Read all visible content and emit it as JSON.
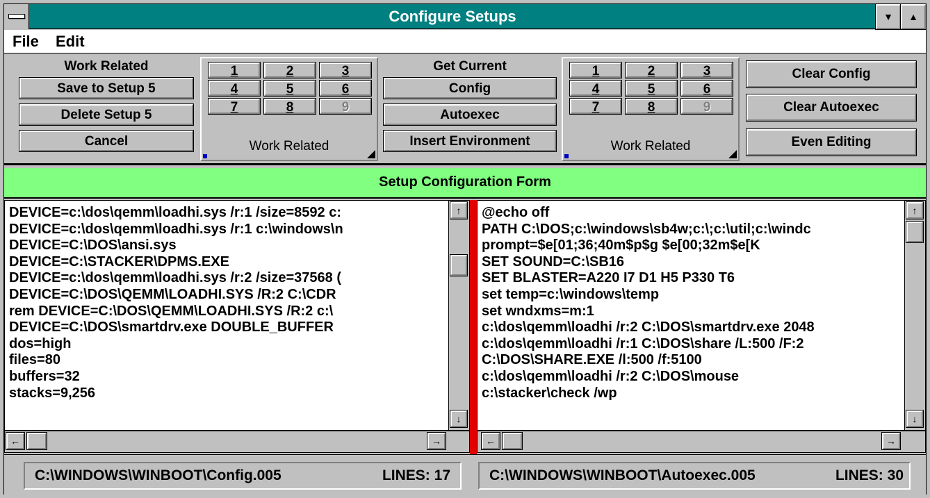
{
  "window": {
    "title": "Configure Setups"
  },
  "menu": {
    "file": "File",
    "edit": "Edit"
  },
  "setup_panel": {
    "name_label": "Work Related",
    "save_button": "Save to Setup 5",
    "delete_button": "Delete Setup 5",
    "cancel_button": "Cancel"
  },
  "config_picker": {
    "numbers": [
      "1",
      "2",
      "3",
      "4",
      "5",
      "6",
      "7",
      "8",
      "9"
    ],
    "disabled": [
      "9"
    ],
    "label": "Work Related"
  },
  "get_current": {
    "label": "Get Current",
    "config_button": "Config",
    "autoexec_button": "Autoexec",
    "insert_env_button": "Insert Environment"
  },
  "autoexec_picker": {
    "numbers": [
      "1",
      "2",
      "3",
      "4",
      "5",
      "6",
      "7",
      "8",
      "9"
    ],
    "disabled": [
      "9"
    ],
    "label": "Work Related"
  },
  "actions": {
    "clear_config": "Clear Config",
    "clear_autoexec": "Clear Autoexec",
    "even_editing": "Even Editing"
  },
  "form_title": "Setup Configuration Form",
  "config_editor": {
    "lines": [
      "DEVICE=c:\\dos\\qemm\\loadhi.sys /r:1 /size=8592 c:",
      "DEVICE=c:\\dos\\qemm\\loadhi.sys /r:1 c:\\windows\\n",
      "DEVICE=C:\\DOS\\ansi.sys",
      "DEVICE=C:\\STACKER\\DPMS.EXE",
      "DEVICE=c:\\dos\\qemm\\loadhi.sys /r:2 /size=37568 (",
      "DEVICE=C:\\DOS\\QEMM\\LOADHI.SYS /R:2 C:\\CDR",
      "rem DEVICE=C:\\DOS\\QEMM\\LOADHI.SYS /R:2 c:\\",
      "DEVICE=C:\\DOS\\smartdrv.exe DOUBLE_BUFFER",
      "dos=high",
      "files=80",
      "buffers=32",
      "stacks=9,256"
    ]
  },
  "autoexec_editor": {
    "lines": [
      "@echo off",
      "PATH C:\\DOS;c:\\windows\\sb4w;c:\\;c:\\util;c:\\windc",
      "prompt=$e[01;36;40m$p$g $e[00;32m$e[K",
      "SET SOUND=C:\\SB16",
      "SET BLASTER=A220 I7 D1 H5 P330 T6",
      "set temp=c:\\windows\\temp",
      "set wndxms=m:1",
      "c:\\dos\\qemm\\loadhi /r:2 C:\\DOS\\smartdrv.exe 2048",
      "c:\\dos\\qemm\\loadhi /r:1 C:\\DOS\\share /L:500 /F:2",
      "C:\\DOS\\SHARE.EXE /l:500 /f:5100",
      "c:\\dos\\qemm\\loadhi /r:2 C:\\DOS\\mouse",
      "c:\\stacker\\check /wp"
    ]
  },
  "status": {
    "config_path": "C:\\WINDOWS\\WINBOOT\\Config.005",
    "config_lines": "LINES: 17",
    "autoexec_path": "C:\\WINDOWS\\WINBOOT\\Autoexec.005",
    "autoexec_lines": "LINES: 30"
  },
  "colors": {
    "title_bar": "#008080",
    "form_header": "#80ff80",
    "splitter": "#e00000"
  },
  "icons": {
    "arrow_up": "▲",
    "arrow_down": "▼",
    "scroll_left": "←",
    "scroll_right": "→",
    "scroll_up": "↑",
    "scroll_down": "↓"
  }
}
